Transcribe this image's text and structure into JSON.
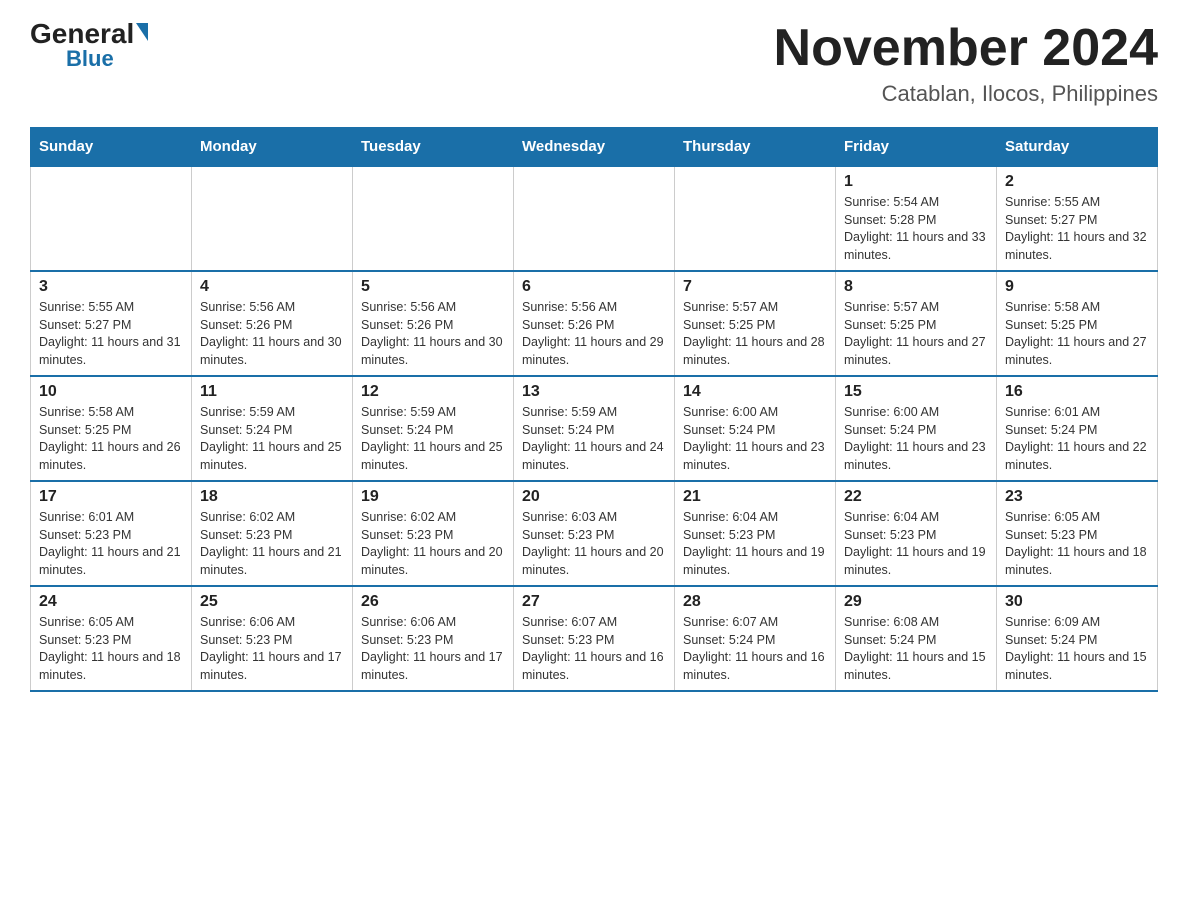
{
  "logo": {
    "general": "General",
    "blue": "Blue"
  },
  "title": "November 2024",
  "subtitle": "Catablan, Ilocos, Philippines",
  "weekdays": [
    "Sunday",
    "Monday",
    "Tuesday",
    "Wednesday",
    "Thursday",
    "Friday",
    "Saturday"
  ],
  "weeks": [
    [
      {
        "day": null
      },
      {
        "day": null
      },
      {
        "day": null
      },
      {
        "day": null
      },
      {
        "day": null
      },
      {
        "day": "1",
        "sunrise": "5:54 AM",
        "sunset": "5:28 PM",
        "daylight": "11 hours and 33 minutes."
      },
      {
        "day": "2",
        "sunrise": "5:55 AM",
        "sunset": "5:27 PM",
        "daylight": "11 hours and 32 minutes."
      }
    ],
    [
      {
        "day": "3",
        "sunrise": "5:55 AM",
        "sunset": "5:27 PM",
        "daylight": "11 hours and 31 minutes."
      },
      {
        "day": "4",
        "sunrise": "5:56 AM",
        "sunset": "5:26 PM",
        "daylight": "11 hours and 30 minutes."
      },
      {
        "day": "5",
        "sunrise": "5:56 AM",
        "sunset": "5:26 PM",
        "daylight": "11 hours and 30 minutes."
      },
      {
        "day": "6",
        "sunrise": "5:56 AM",
        "sunset": "5:26 PM",
        "daylight": "11 hours and 29 minutes."
      },
      {
        "day": "7",
        "sunrise": "5:57 AM",
        "sunset": "5:25 PM",
        "daylight": "11 hours and 28 minutes."
      },
      {
        "day": "8",
        "sunrise": "5:57 AM",
        "sunset": "5:25 PM",
        "daylight": "11 hours and 27 minutes."
      },
      {
        "day": "9",
        "sunrise": "5:58 AM",
        "sunset": "5:25 PM",
        "daylight": "11 hours and 27 minutes."
      }
    ],
    [
      {
        "day": "10",
        "sunrise": "5:58 AM",
        "sunset": "5:25 PM",
        "daylight": "11 hours and 26 minutes."
      },
      {
        "day": "11",
        "sunrise": "5:59 AM",
        "sunset": "5:24 PM",
        "daylight": "11 hours and 25 minutes."
      },
      {
        "day": "12",
        "sunrise": "5:59 AM",
        "sunset": "5:24 PM",
        "daylight": "11 hours and 25 minutes."
      },
      {
        "day": "13",
        "sunrise": "5:59 AM",
        "sunset": "5:24 PM",
        "daylight": "11 hours and 24 minutes."
      },
      {
        "day": "14",
        "sunrise": "6:00 AM",
        "sunset": "5:24 PM",
        "daylight": "11 hours and 23 minutes."
      },
      {
        "day": "15",
        "sunrise": "6:00 AM",
        "sunset": "5:24 PM",
        "daylight": "11 hours and 23 minutes."
      },
      {
        "day": "16",
        "sunrise": "6:01 AM",
        "sunset": "5:24 PM",
        "daylight": "11 hours and 22 minutes."
      }
    ],
    [
      {
        "day": "17",
        "sunrise": "6:01 AM",
        "sunset": "5:23 PM",
        "daylight": "11 hours and 21 minutes."
      },
      {
        "day": "18",
        "sunrise": "6:02 AM",
        "sunset": "5:23 PM",
        "daylight": "11 hours and 21 minutes."
      },
      {
        "day": "19",
        "sunrise": "6:02 AM",
        "sunset": "5:23 PM",
        "daylight": "11 hours and 20 minutes."
      },
      {
        "day": "20",
        "sunrise": "6:03 AM",
        "sunset": "5:23 PM",
        "daylight": "11 hours and 20 minutes."
      },
      {
        "day": "21",
        "sunrise": "6:04 AM",
        "sunset": "5:23 PM",
        "daylight": "11 hours and 19 minutes."
      },
      {
        "day": "22",
        "sunrise": "6:04 AM",
        "sunset": "5:23 PM",
        "daylight": "11 hours and 19 minutes."
      },
      {
        "day": "23",
        "sunrise": "6:05 AM",
        "sunset": "5:23 PM",
        "daylight": "11 hours and 18 minutes."
      }
    ],
    [
      {
        "day": "24",
        "sunrise": "6:05 AM",
        "sunset": "5:23 PM",
        "daylight": "11 hours and 18 minutes."
      },
      {
        "day": "25",
        "sunrise": "6:06 AM",
        "sunset": "5:23 PM",
        "daylight": "11 hours and 17 minutes."
      },
      {
        "day": "26",
        "sunrise": "6:06 AM",
        "sunset": "5:23 PM",
        "daylight": "11 hours and 17 minutes."
      },
      {
        "day": "27",
        "sunrise": "6:07 AM",
        "sunset": "5:23 PM",
        "daylight": "11 hours and 16 minutes."
      },
      {
        "day": "28",
        "sunrise": "6:07 AM",
        "sunset": "5:24 PM",
        "daylight": "11 hours and 16 minutes."
      },
      {
        "day": "29",
        "sunrise": "6:08 AM",
        "sunset": "5:24 PM",
        "daylight": "11 hours and 15 minutes."
      },
      {
        "day": "30",
        "sunrise": "6:09 AM",
        "sunset": "5:24 PM",
        "daylight": "11 hours and 15 minutes."
      }
    ]
  ]
}
